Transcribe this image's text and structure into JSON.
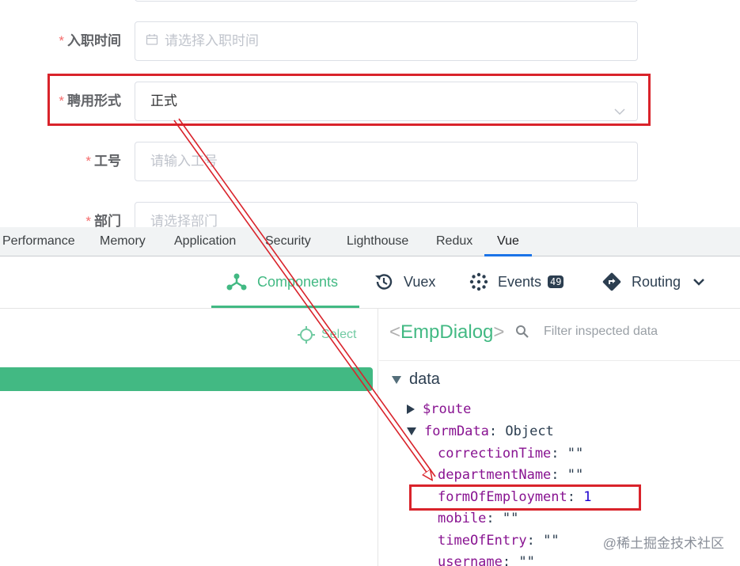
{
  "form": {
    "rows": [
      {
        "label": "入职时间",
        "placeholder": "请选择入职时间"
      },
      {
        "label": "聘用形式",
        "value": "正式"
      },
      {
        "label": "工号",
        "placeholder": "请输入工号"
      },
      {
        "label": "部门",
        "placeholder": "请选择部门"
      }
    ],
    "required_mark": "*"
  },
  "devtools_tabs": [
    "Performance",
    "Memory",
    "Application",
    "Security",
    "Lighthouse",
    "Redux",
    "Vue"
  ],
  "active_tab": "Vue",
  "vue_toolbar": {
    "components": "Components",
    "vuex": "Vuex",
    "events": "Events",
    "events_count": "49",
    "routing": "Routing"
  },
  "left_pane": {
    "select_label": "Select"
  },
  "inspector": {
    "component_name": "EmpDialog",
    "bracket_open": "<",
    "bracket_close": ">",
    "filter_placeholder": "Filter inspected data",
    "section": "data",
    "route_key": "$route",
    "formdata_key": "formData",
    "formdata_type": "Object",
    "fields": [
      {
        "key": "correctionTime",
        "value": "\"\""
      },
      {
        "key": "departmentName",
        "value": "\"\""
      },
      {
        "key": "formOfEmployment",
        "value": "1"
      },
      {
        "key": "mobile",
        "value": "\"\""
      },
      {
        "key": "timeOfEntry",
        "value": "\"\""
      },
      {
        "key": "username",
        "value": "\"\""
      }
    ]
  },
  "watermark": "@稀土掘金技术社区",
  "colors": {
    "vue_green": "#42b983",
    "highlight_red": "#d9232b",
    "required_red": "#f56c6c",
    "tab_blue": "#1a73e8"
  }
}
